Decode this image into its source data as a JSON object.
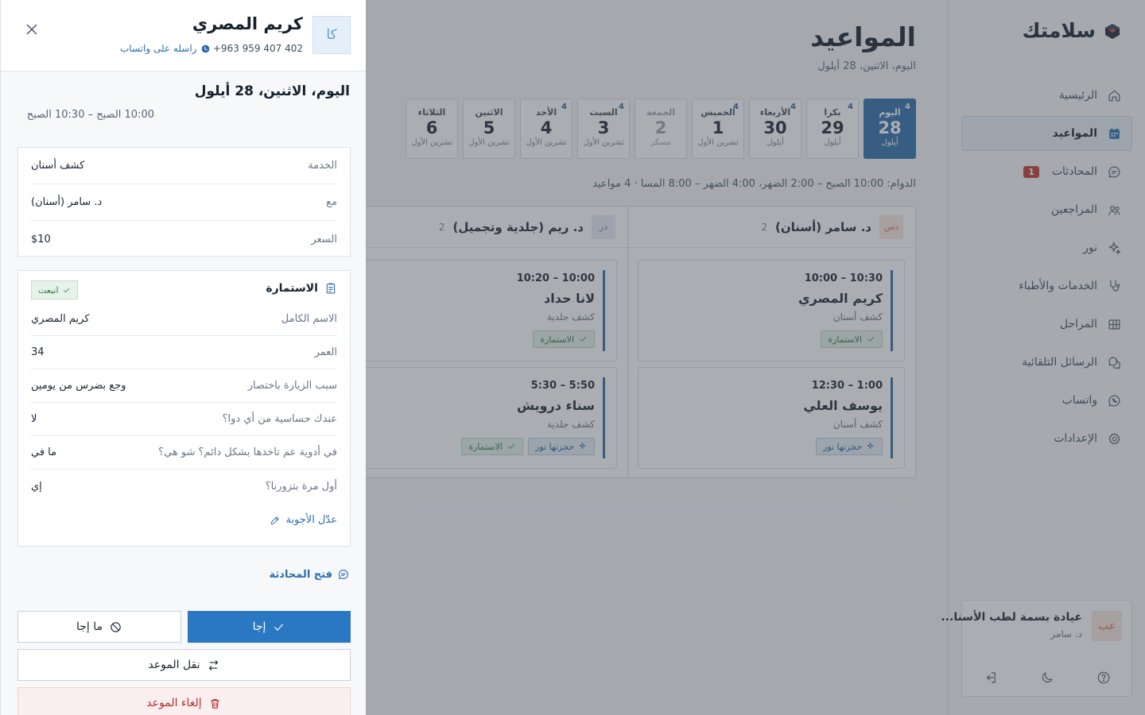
{
  "brand": {
    "name": "سلامتك"
  },
  "nav": [
    {
      "label": "الرئيسية",
      "icon": "home-icon",
      "active": false
    },
    {
      "label": "المواعيد",
      "icon": "calendar-icon",
      "active": true
    },
    {
      "label": "المحادثات",
      "icon": "chat-icon",
      "active": false,
      "badge": "1"
    },
    {
      "label": "المراجعين",
      "icon": "users-icon",
      "active": false
    },
    {
      "label": "نور",
      "icon": "sparkle-icon",
      "active": false
    },
    {
      "label": "الخدمات والأطباء",
      "icon": "stethoscope-icon",
      "active": false
    },
    {
      "label": "المراحل",
      "icon": "stages-icon",
      "active": false
    },
    {
      "label": "الرسائل التلقائية",
      "icon": "auto-messages-icon",
      "active": false
    },
    {
      "label": "واتساب",
      "icon": "whatsapp-icon",
      "active": false
    },
    {
      "label": "الإعدادات",
      "icon": "gear-icon",
      "active": false
    }
  ],
  "clinic": {
    "initials": "عب",
    "name": "عيادة بسمة لطب الأسنا...",
    "doctor": "د. سامر"
  },
  "page": {
    "title": "المواعيد",
    "subtitle": "اليوم، الاثنين، 28 أيلول"
  },
  "days": [
    {
      "name": "اليوم",
      "date": "28",
      "month": "أيلول",
      "count": "4",
      "selected": true
    },
    {
      "name": "بكرا",
      "date": "29",
      "month": "أيلول",
      "count": "4"
    },
    {
      "name": "الأربعاء",
      "date": "30",
      "month": "أيلول",
      "count": "4"
    },
    {
      "name": "الخميس",
      "date": "1",
      "month": "تشرين الأول",
      "count": "4"
    },
    {
      "name": "الجمعة",
      "date": "2",
      "month": "مسكر",
      "count": "",
      "off": true
    },
    {
      "name": "السبت",
      "date": "3",
      "month": "تشرين الأول",
      "count": "4"
    },
    {
      "name": "الأحد",
      "date": "4",
      "month": "تشرين الأول",
      "count": "4"
    },
    {
      "name": "الاثنين",
      "date": "5",
      "month": "تشرين الأول",
      "count": ""
    },
    {
      "name": "الثلاثاء",
      "date": "6",
      "month": "تشرين الأول",
      "count": ""
    }
  ],
  "hours": "الدوام: 10:00 الصبح – 2:00 الضهر، 4:00 الضهر – 8:00 المسا · 4 مواعيد",
  "columns": [
    {
      "initials": "دس",
      "avatar_bg": "#fbe6df",
      "avatar_fg": "#d9735a",
      "name": "د. سامر (أسنان)",
      "count": "2",
      "appointments": [
        {
          "time": "10:00 – 10:30",
          "patient": "كريم المصري",
          "service": "كشف أسنان",
          "tags": [
            "form"
          ]
        },
        {
          "time": "12:30 – 1:00",
          "patient": "يوسف العلي",
          "service": "كشف أسنان",
          "tags": [
            "nour"
          ]
        }
      ]
    },
    {
      "initials": "در",
      "avatar_bg": "#e8ebf6",
      "avatar_fg": "#6b7aa8",
      "name": "د. ريم (جلدية وتجميل)",
      "count": "2",
      "appointments": [
        {
          "time": "10:20 – 10:00",
          "patient": "لانا حداد",
          "service": "كشف جلدية",
          "tags": [
            "form"
          ]
        },
        {
          "time": "5:30 – 5:50",
          "patient": "سناء درويش",
          "service": "كشف جلدية",
          "tags": [
            "nour",
            "form"
          ]
        }
      ]
    }
  ],
  "tag_labels": {
    "form": "الاستمارة",
    "nour": "حجزتها نور"
  },
  "drawer": {
    "initials": "كا",
    "patient_name": "كريم المصري",
    "phone": "+963 959 407 402",
    "whatsapp_link": "راسله على واتساب",
    "date": "اليوم، الاثنين، 28 أيلول",
    "time": "10:00 الصبح – 10:30 الصبح",
    "details": [
      {
        "label": "الخدمة",
        "value": "كشف أسنان"
      },
      {
        "label": "مع",
        "value": "د. سامر (أسنان)"
      },
      {
        "label": "السعر",
        "value": "$10"
      }
    ],
    "form": {
      "title": "الاستمارة",
      "status": "انبعت",
      "answers": [
        {
          "q": "الاسم الكامل",
          "a": "كريم المصري"
        },
        {
          "q": "العمر",
          "a": "34"
        },
        {
          "q": "سبب الزيارة باختصار",
          "a": "وجع بضرس من يومين"
        },
        {
          "q": "عندك حساسية من أي دوا؟",
          "a": "لا"
        },
        {
          "q": "في أدوية عم تاخدها بشكل دائم؟ شو هي؟",
          "a": "ما في"
        },
        {
          "q": "أول مرة بتزورنا؟",
          "a": "إي"
        }
      ],
      "edit_label": "عدّل الأجوبة"
    },
    "open_chat": "فتح المحادثة",
    "actions": {
      "attended": "إجا",
      "no_show": "ما إجا",
      "move": "نقل الموعد",
      "cancel": "إلغاء الموعد"
    }
  },
  "colors": {
    "accent": "#2b6cab",
    "danger": "#b23030",
    "success": "#2f7a47"
  }
}
